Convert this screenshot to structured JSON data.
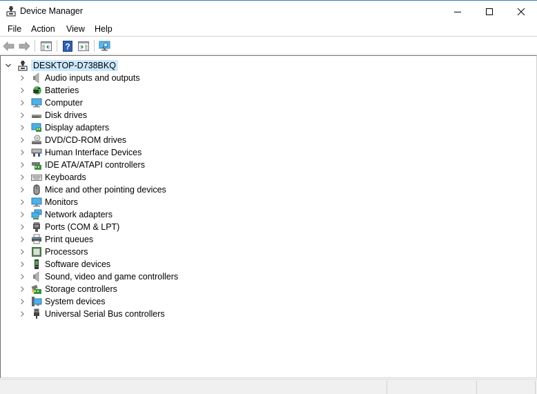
{
  "window": {
    "title": "Device Manager",
    "accent_color": "#3a7bbf",
    "controls": {
      "minimize": "minimize",
      "maximize": "maximize",
      "close": "close"
    }
  },
  "menubar": {
    "items": [
      {
        "label": "File"
      },
      {
        "label": "Action"
      },
      {
        "label": "View"
      },
      {
        "label": "Help"
      }
    ]
  },
  "toolbar": {
    "buttons": [
      {
        "icon": "back-arrow-icon",
        "enabled": false
      },
      {
        "icon": "forward-arrow-icon",
        "enabled": false
      },
      {
        "icon": "show-hide-console-tree-icon",
        "enabled": true
      },
      {
        "icon": "help-icon",
        "enabled": true
      },
      {
        "icon": "show-hide-action-pane-icon",
        "enabled": true
      },
      {
        "icon": "scan-hardware-changes-icon",
        "enabled": true
      }
    ]
  },
  "tree": {
    "root": {
      "label": "DESKTOP-D738BKQ",
      "expanded": true,
      "selected": true,
      "selection_color": "#cce8ff"
    },
    "categories": [
      {
        "label": "Audio inputs and outputs",
        "icon": "speaker-icon"
      },
      {
        "label": "Batteries",
        "icon": "battery-icon"
      },
      {
        "label": "Computer",
        "icon": "computer-icon"
      },
      {
        "label": "Disk drives",
        "icon": "disk-drive-icon"
      },
      {
        "label": "Display adapters",
        "icon": "display-adapter-icon"
      },
      {
        "label": "DVD/CD-ROM drives",
        "icon": "dvd-drive-icon"
      },
      {
        "label": "Human Interface Devices",
        "icon": "hid-icon"
      },
      {
        "label": "IDE ATA/ATAPI controllers",
        "icon": "ide-controller-icon"
      },
      {
        "label": "Keyboards",
        "icon": "keyboard-icon"
      },
      {
        "label": "Mice and other pointing devices",
        "icon": "mouse-icon"
      },
      {
        "label": "Monitors",
        "icon": "monitor-icon"
      },
      {
        "label": "Network adapters",
        "icon": "network-adapter-icon"
      },
      {
        "label": "Ports (COM & LPT)",
        "icon": "port-icon"
      },
      {
        "label": "Print queues",
        "icon": "printer-icon"
      },
      {
        "label": "Processors",
        "icon": "processor-icon"
      },
      {
        "label": "Software devices",
        "icon": "software-device-icon"
      },
      {
        "label": "Sound, video and game controllers",
        "icon": "sound-controller-icon"
      },
      {
        "label": "Storage controllers",
        "icon": "storage-controller-icon"
      },
      {
        "label": "System devices",
        "icon": "system-devices-icon"
      },
      {
        "label": "Universal Serial Bus controllers",
        "icon": "usb-icon"
      }
    ]
  },
  "statusbar": {
    "cells": [
      "",
      "",
      ""
    ]
  }
}
